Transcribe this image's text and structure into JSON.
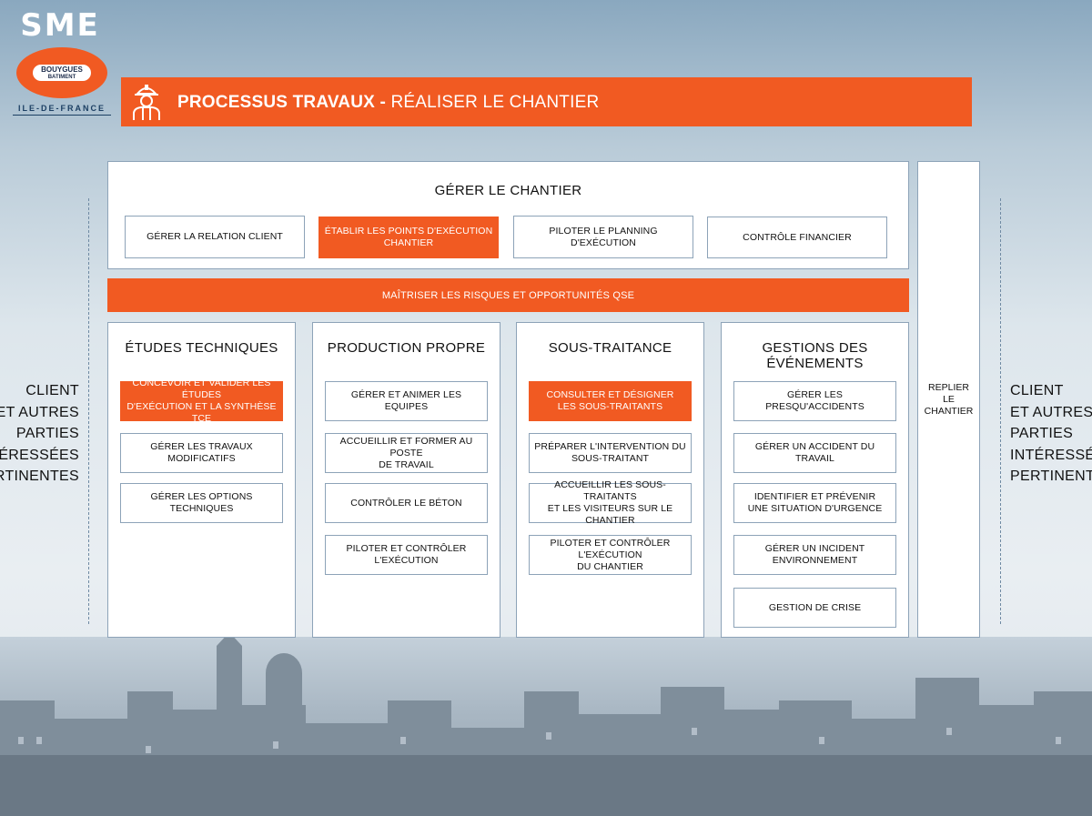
{
  "logo": {
    "brand": "SME",
    "company_line1": "BOUYGUES",
    "company_line2": "BATIMENT",
    "region": "ILE-DE-FRANCE"
  },
  "header": {
    "icon": "construction-worker-icon",
    "title_bold": "PROCESSUS TRAVAUX -",
    "title_light": " RÉALISER LE CHANTIER"
  },
  "gerer": {
    "title": "GÉRER LE CHANTIER",
    "items": [
      {
        "label": "GÉRER LA RELATION CLIENT",
        "highlight": false
      },
      {
        "label": "ÉTABLIR LES POINTS D'EXÉCUTION CHANTIER",
        "highlight": true
      },
      {
        "label": "PILOTER LE PLANNING D'EXÉCUTION",
        "highlight": false
      },
      {
        "label": "CONTRÔLE  FINANCIER",
        "highlight": false
      }
    ]
  },
  "risk_bar": "MAÎTRISER LES RISQUES ET OPPORTUNITÉS QSE",
  "columns": [
    {
      "title": "ÉTUDES TECHNIQUES",
      "items": [
        {
          "label": "CONCEVOIR ET VALIDER LES ÉTUDES\nD'EXÉCUTION ET LA SYNTHÈSE TCE",
          "highlight": true
        },
        {
          "label": "GÉRER LES TRAVAUX MODIFICATIFS",
          "highlight": false
        },
        {
          "label": "GÉRER LES OPTIONS TECHNIQUES",
          "highlight": false
        }
      ]
    },
    {
      "title": "PRODUCTION PROPRE",
      "items": [
        {
          "label": "GÉRER ET ANIMER LES EQUIPES",
          "highlight": false
        },
        {
          "label": "ACCUEILLIR ET FORMER AU POSTE\nDE TRAVAIL",
          "highlight": false
        },
        {
          "label": "CONTRÔLER LE BÉTON",
          "highlight": false
        },
        {
          "label": "PILOTER ET CONTRÔLER L'EXÉCUTION",
          "highlight": false
        }
      ]
    },
    {
      "title": "SOUS-TRAITANCE",
      "items": [
        {
          "label": "CONSULTER ET DÉSIGNER\nLES SOUS-TRAITANTS",
          "highlight": true
        },
        {
          "label": "PRÉPARER L'INTERVENTION DU\nSOUS-TRAITANT",
          "highlight": false
        },
        {
          "label": "ACCUEILLIR LES SOUS-TRAITANTS\nET LES  VISITEURS SUR LE CHANTIER",
          "highlight": false
        },
        {
          "label": "PILOTER ET CONTRÔLER L'EXÉCUTION\nDU CHANTIER",
          "highlight": false
        }
      ]
    },
    {
      "title": "GESTIONS DES ÉVÉNEMENTS",
      "items": [
        {
          "label": "GÉRER LES PRESQU'ACCIDENTS",
          "highlight": false
        },
        {
          "label": "GÉRER UN ACCIDENT DU TRAVAIL",
          "highlight": false
        },
        {
          "label": "IDENTIFIER ET PRÉVENIR\nUNE SITUATION D'URGENCE",
          "highlight": false
        },
        {
          "label": "GÉRER UN INCIDENT ENVIRONNEMENT",
          "highlight": false
        },
        {
          "label": "GESTION DE CRISE",
          "highlight": false
        }
      ]
    }
  ],
  "replier": "REPLIER\nLE CHANTIER",
  "side_left": "CLIENT\nET AUTRES\nPARTIES\nINTÉRESSÉES\nPERTINENTES",
  "side_right": "CLIENT\nET AUTRES\nPARTIES\nINTÉRESSÉES\nPERTINENTES",
  "colors": {
    "accent": "#f15a22",
    "border": "#8da3b8",
    "navy": "#1c3f63"
  }
}
